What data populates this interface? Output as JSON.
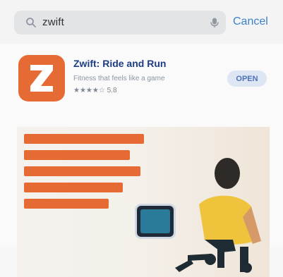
{
  "search": {
    "value": "zwift",
    "cancel_label": "Cancel"
  },
  "app": {
    "title": "Zwift: Ride and Run",
    "subtitle": "Fitness that feels like a game",
    "rating": "★★★★☆ 5.8",
    "open_label": "OPEN",
    "brand_color": "#e56a34"
  },
  "icons": {
    "search": "search-icon",
    "mic": "microphone-icon",
    "app": "zwift-logo-icon"
  }
}
